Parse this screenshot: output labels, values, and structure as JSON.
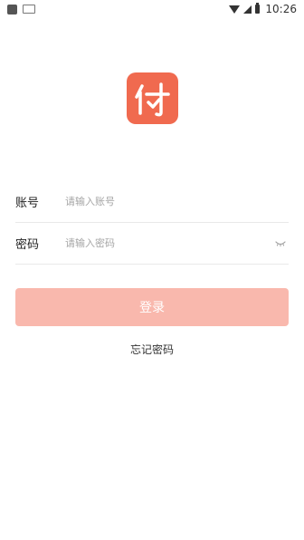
{
  "status_bar": {
    "time": "10:26"
  },
  "brand": {
    "logo_char": "付",
    "accent_color": "#f06a4f"
  },
  "form": {
    "account": {
      "label": "账号",
      "placeholder": "请输入账号",
      "value": ""
    },
    "password": {
      "label": "密码",
      "placeholder": "请输入密码",
      "value": ""
    }
  },
  "actions": {
    "login_label": "登录",
    "forgot_label": "忘记密码",
    "login_color": "#f9b8ad"
  }
}
